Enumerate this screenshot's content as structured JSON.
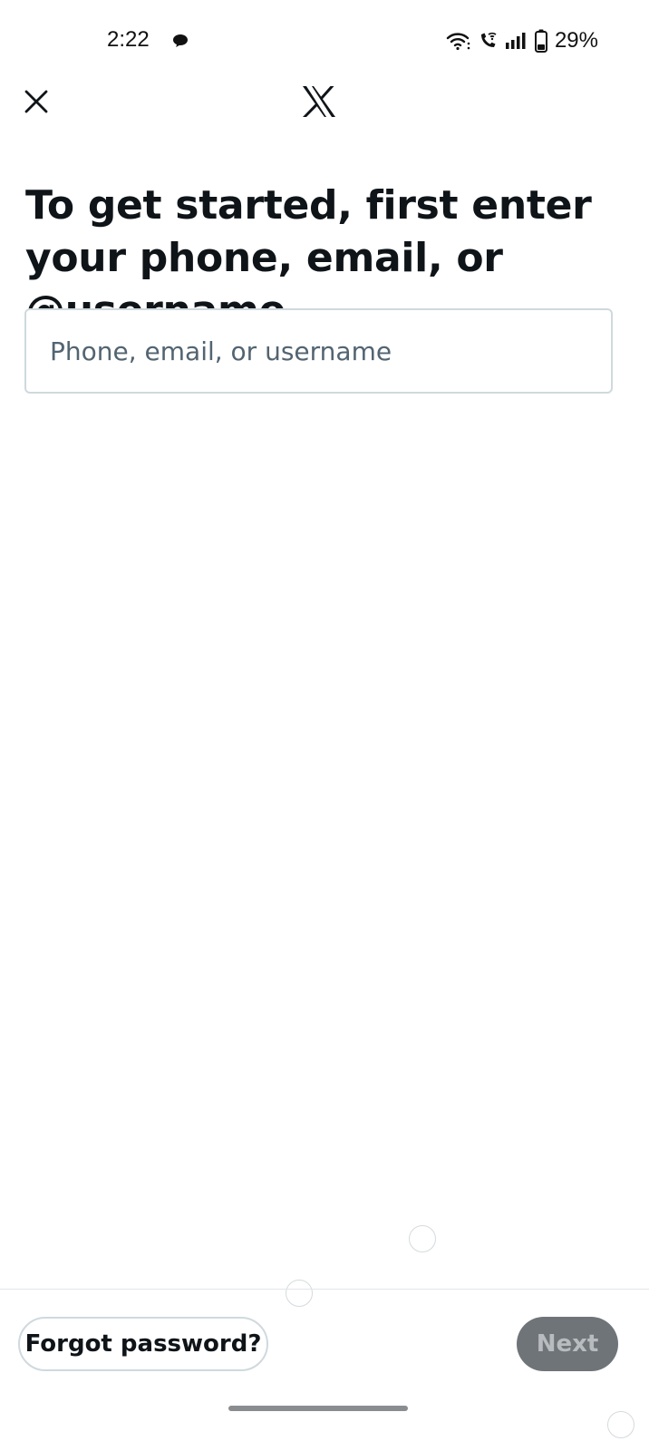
{
  "status_bar": {
    "time": "2:22",
    "battery_percent": "29%",
    "icons": [
      "chat-bubble-icon",
      "wifi-icon",
      "wifi-calling-icon",
      "signal-icon",
      "battery-icon"
    ]
  },
  "header": {
    "close_icon": "close-icon",
    "logo": "x-logo"
  },
  "main": {
    "heading": "To get started, first enter your phone, email, or @username",
    "input": {
      "value": "",
      "placeholder": "Phone, email, or username"
    }
  },
  "footer": {
    "forgot_password_label": "Forgot password?",
    "next_label": "Next",
    "next_enabled": false
  },
  "colors": {
    "text_primary": "#0f1419",
    "text_secondary": "#536471",
    "border": "#cfd9de",
    "next_disabled_bg": "#6f7479"
  }
}
